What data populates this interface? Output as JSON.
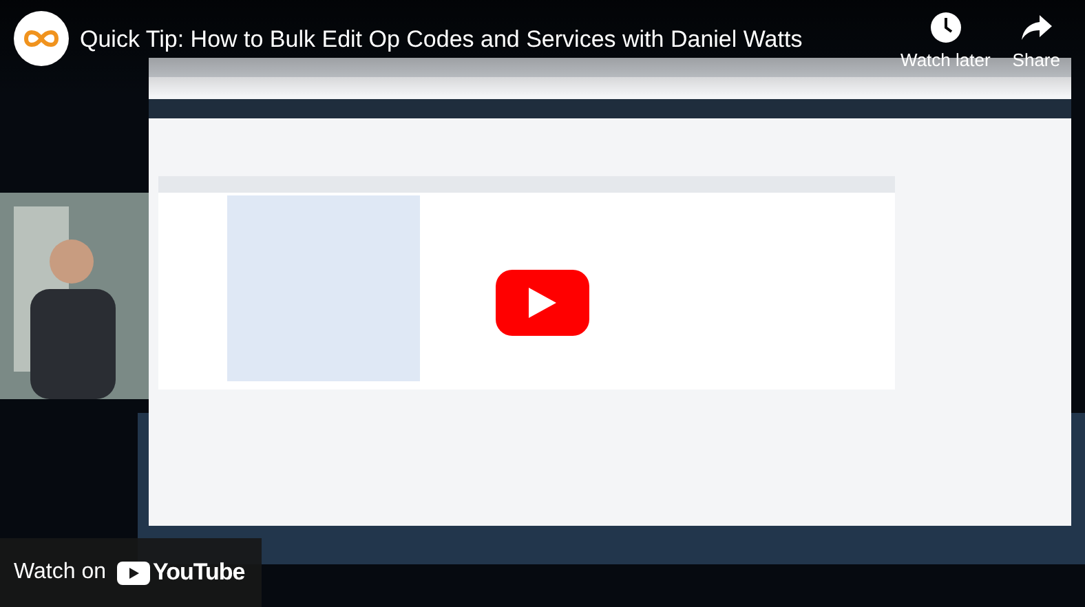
{
  "video": {
    "title": "Quick Tip: How to Bulk Edit Op Codes and Services with Daniel Watts",
    "actions": [
      {
        "kind": "watch_later",
        "label": "Watch later"
      },
      {
        "kind": "share",
        "label": "Share"
      }
    ],
    "watch_on": {
      "label": "Watch on",
      "brand": "YouTube"
    }
  }
}
